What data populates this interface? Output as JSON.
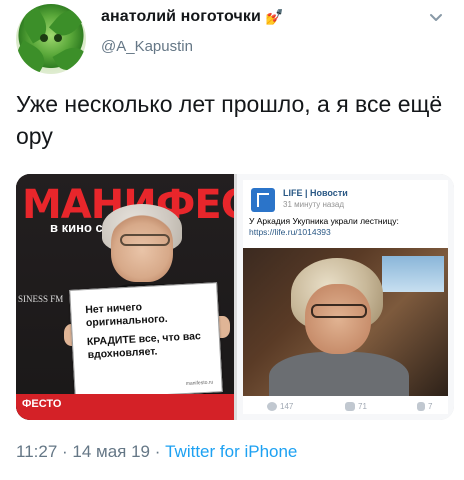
{
  "tweet": {
    "display_name": "анатолий ноготочки",
    "name_emoji": "💅",
    "handle": "@A_Kapustin",
    "text": "Уже несколько лет прошло, а я все ещё ору",
    "timestamp": "11:27 · 14 мая 19 · ",
    "source": "Twitter for iPhone"
  },
  "left_photo": {
    "banner_title": "МАНИФЕС",
    "banner_sub": "в кино  с 8 ию",
    "side_text": "SINESS FM",
    "strip_text": "ФЕСТО",
    "sign_line1": "Нет ничего оригинального.",
    "sign_line2": "КРАДИТЕ все, что вас вдохновляет.",
    "sign_footer": "manifesto.ru"
  },
  "right_photo": {
    "source_name": "LIFE | Новости",
    "source_time": "31 минуту назад",
    "post_text": "У Аркадия Укупника украли лестницу: ",
    "post_link": "https://life.ru/1014393",
    "likes": "147",
    "comments": "71",
    "reposts": "7"
  },
  "icons": {
    "menu": "chevron-down-icon",
    "avatar": "avatar"
  },
  "colors": {
    "link": "#1da1f2",
    "muted": "#657786",
    "text": "#14171a"
  }
}
